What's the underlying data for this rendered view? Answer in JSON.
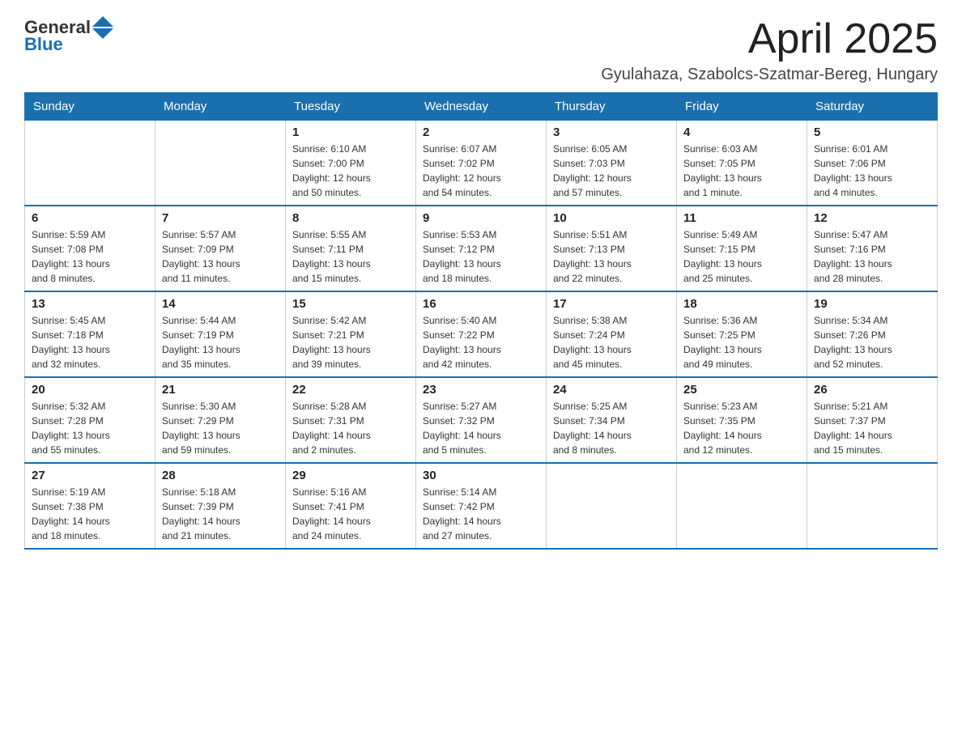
{
  "header": {
    "logo_general": "General",
    "logo_blue": "Blue",
    "month_year": "April 2025",
    "location": "Gyulahaza, Szabolcs-Szatmar-Bereg, Hungary"
  },
  "calendar": {
    "days_of_week": [
      "Sunday",
      "Monday",
      "Tuesday",
      "Wednesday",
      "Thursday",
      "Friday",
      "Saturday"
    ],
    "weeks": [
      [
        {
          "day": "",
          "info": ""
        },
        {
          "day": "",
          "info": ""
        },
        {
          "day": "1",
          "info": "Sunrise: 6:10 AM\nSunset: 7:00 PM\nDaylight: 12 hours\nand 50 minutes."
        },
        {
          "day": "2",
          "info": "Sunrise: 6:07 AM\nSunset: 7:02 PM\nDaylight: 12 hours\nand 54 minutes."
        },
        {
          "day": "3",
          "info": "Sunrise: 6:05 AM\nSunset: 7:03 PM\nDaylight: 12 hours\nand 57 minutes."
        },
        {
          "day": "4",
          "info": "Sunrise: 6:03 AM\nSunset: 7:05 PM\nDaylight: 13 hours\nand 1 minute."
        },
        {
          "day": "5",
          "info": "Sunrise: 6:01 AM\nSunset: 7:06 PM\nDaylight: 13 hours\nand 4 minutes."
        }
      ],
      [
        {
          "day": "6",
          "info": "Sunrise: 5:59 AM\nSunset: 7:08 PM\nDaylight: 13 hours\nand 8 minutes."
        },
        {
          "day": "7",
          "info": "Sunrise: 5:57 AM\nSunset: 7:09 PM\nDaylight: 13 hours\nand 11 minutes."
        },
        {
          "day": "8",
          "info": "Sunrise: 5:55 AM\nSunset: 7:11 PM\nDaylight: 13 hours\nand 15 minutes."
        },
        {
          "day": "9",
          "info": "Sunrise: 5:53 AM\nSunset: 7:12 PM\nDaylight: 13 hours\nand 18 minutes."
        },
        {
          "day": "10",
          "info": "Sunrise: 5:51 AM\nSunset: 7:13 PM\nDaylight: 13 hours\nand 22 minutes."
        },
        {
          "day": "11",
          "info": "Sunrise: 5:49 AM\nSunset: 7:15 PM\nDaylight: 13 hours\nand 25 minutes."
        },
        {
          "day": "12",
          "info": "Sunrise: 5:47 AM\nSunset: 7:16 PM\nDaylight: 13 hours\nand 28 minutes."
        }
      ],
      [
        {
          "day": "13",
          "info": "Sunrise: 5:45 AM\nSunset: 7:18 PM\nDaylight: 13 hours\nand 32 minutes."
        },
        {
          "day": "14",
          "info": "Sunrise: 5:44 AM\nSunset: 7:19 PM\nDaylight: 13 hours\nand 35 minutes."
        },
        {
          "day": "15",
          "info": "Sunrise: 5:42 AM\nSunset: 7:21 PM\nDaylight: 13 hours\nand 39 minutes."
        },
        {
          "day": "16",
          "info": "Sunrise: 5:40 AM\nSunset: 7:22 PM\nDaylight: 13 hours\nand 42 minutes."
        },
        {
          "day": "17",
          "info": "Sunrise: 5:38 AM\nSunset: 7:24 PM\nDaylight: 13 hours\nand 45 minutes."
        },
        {
          "day": "18",
          "info": "Sunrise: 5:36 AM\nSunset: 7:25 PM\nDaylight: 13 hours\nand 49 minutes."
        },
        {
          "day": "19",
          "info": "Sunrise: 5:34 AM\nSunset: 7:26 PM\nDaylight: 13 hours\nand 52 minutes."
        }
      ],
      [
        {
          "day": "20",
          "info": "Sunrise: 5:32 AM\nSunset: 7:28 PM\nDaylight: 13 hours\nand 55 minutes."
        },
        {
          "day": "21",
          "info": "Sunrise: 5:30 AM\nSunset: 7:29 PM\nDaylight: 13 hours\nand 59 minutes."
        },
        {
          "day": "22",
          "info": "Sunrise: 5:28 AM\nSunset: 7:31 PM\nDaylight: 14 hours\nand 2 minutes."
        },
        {
          "day": "23",
          "info": "Sunrise: 5:27 AM\nSunset: 7:32 PM\nDaylight: 14 hours\nand 5 minutes."
        },
        {
          "day": "24",
          "info": "Sunrise: 5:25 AM\nSunset: 7:34 PM\nDaylight: 14 hours\nand 8 minutes."
        },
        {
          "day": "25",
          "info": "Sunrise: 5:23 AM\nSunset: 7:35 PM\nDaylight: 14 hours\nand 12 minutes."
        },
        {
          "day": "26",
          "info": "Sunrise: 5:21 AM\nSunset: 7:37 PM\nDaylight: 14 hours\nand 15 minutes."
        }
      ],
      [
        {
          "day": "27",
          "info": "Sunrise: 5:19 AM\nSunset: 7:38 PM\nDaylight: 14 hours\nand 18 minutes."
        },
        {
          "day": "28",
          "info": "Sunrise: 5:18 AM\nSunset: 7:39 PM\nDaylight: 14 hours\nand 21 minutes."
        },
        {
          "day": "29",
          "info": "Sunrise: 5:16 AM\nSunset: 7:41 PM\nDaylight: 14 hours\nand 24 minutes."
        },
        {
          "day": "30",
          "info": "Sunrise: 5:14 AM\nSunset: 7:42 PM\nDaylight: 14 hours\nand 27 minutes."
        },
        {
          "day": "",
          "info": ""
        },
        {
          "day": "",
          "info": ""
        },
        {
          "day": "",
          "info": ""
        }
      ]
    ]
  }
}
